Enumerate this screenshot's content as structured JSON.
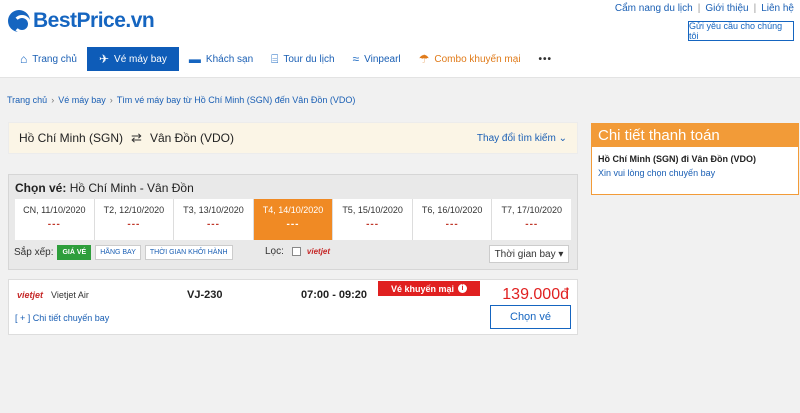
{
  "brand": {
    "name": "BestPrice.vn",
    "color": "#1565c0",
    "accent": "#f29b38"
  },
  "top_links": [
    "Cẩm nang du lịch",
    "Giới thiệu",
    "Liên hệ"
  ],
  "request_button": "Gửi yêu cầu cho chúng tôi",
  "nav": [
    {
      "label": "Trang chủ",
      "icon": "home-icon",
      "glyph": "⌂"
    },
    {
      "label": "Vé máy bay",
      "icon": "plane-icon",
      "glyph": "✈",
      "active": true
    },
    {
      "label": "Khách sạn",
      "icon": "bed-icon",
      "glyph": "▬"
    },
    {
      "label": "Tour du lịch",
      "icon": "luggage-icon",
      "glyph": "⌸"
    },
    {
      "label": "Vinpearl",
      "icon": "vinpearl-icon",
      "glyph": "≈"
    },
    {
      "label": "Combo khuyến mại",
      "icon": "beach-icon",
      "glyph": "☂"
    },
    {
      "label": "•••",
      "icon": "more-icon",
      "glyph": ""
    }
  ],
  "breadcrumb": [
    "Trang chủ",
    "Vé máy bay",
    "Tìm vé máy bay từ Hồ Chí Minh (SGN) đến Vân Đồn (VDO)"
  ],
  "route": {
    "from": "Hồ Chí Minh (SGN)",
    "to": "Vân Đồn (VDO)",
    "change_label": "Thay đổi tìm kiếm"
  },
  "select": {
    "title_prefix": "Chọn vé:",
    "title_route": "Hồ Chí Minh - Vân Đồn",
    "dates": [
      {
        "label": "CN, 11/10/2020",
        "price": "---"
      },
      {
        "label": "T2, 12/10/2020",
        "price": "---"
      },
      {
        "label": "T3, 13/10/2020",
        "price": "---"
      },
      {
        "label": "T4, 14/10/2020",
        "price": "---",
        "active": true
      },
      {
        "label": "T5, 15/10/2020",
        "price": "---"
      },
      {
        "label": "T6, 16/10/2020",
        "price": "---"
      },
      {
        "label": "T7, 17/10/2020",
        "price": "---"
      }
    ],
    "sort_label": "Sắp xếp:",
    "sort_options": [
      "GIÁ VÉ",
      "HÃNG BAY",
      "THỜI GIAN KHỞI HÀNH"
    ],
    "filter_label": "Lọc:",
    "filter_airline": "vietjet",
    "time_select": "Thời gian bay"
  },
  "flight": {
    "airline_logo": "vietjet",
    "airline": "Vietjet Air",
    "code": "VJ-230",
    "time": "07:00 - 09:20",
    "promo": "Vé khuyến mại",
    "price": "139.000đ",
    "detail_link": "[ + ] Chi tiết chuyến bay",
    "choose_label": "Chọn vé"
  },
  "side": {
    "title": "Chi tiết thanh toán",
    "route": "Hồ Chí Minh (SGN) đi Vân Đồn (VDO)",
    "hint": "Xin vui lòng chọn chuyến bay"
  }
}
